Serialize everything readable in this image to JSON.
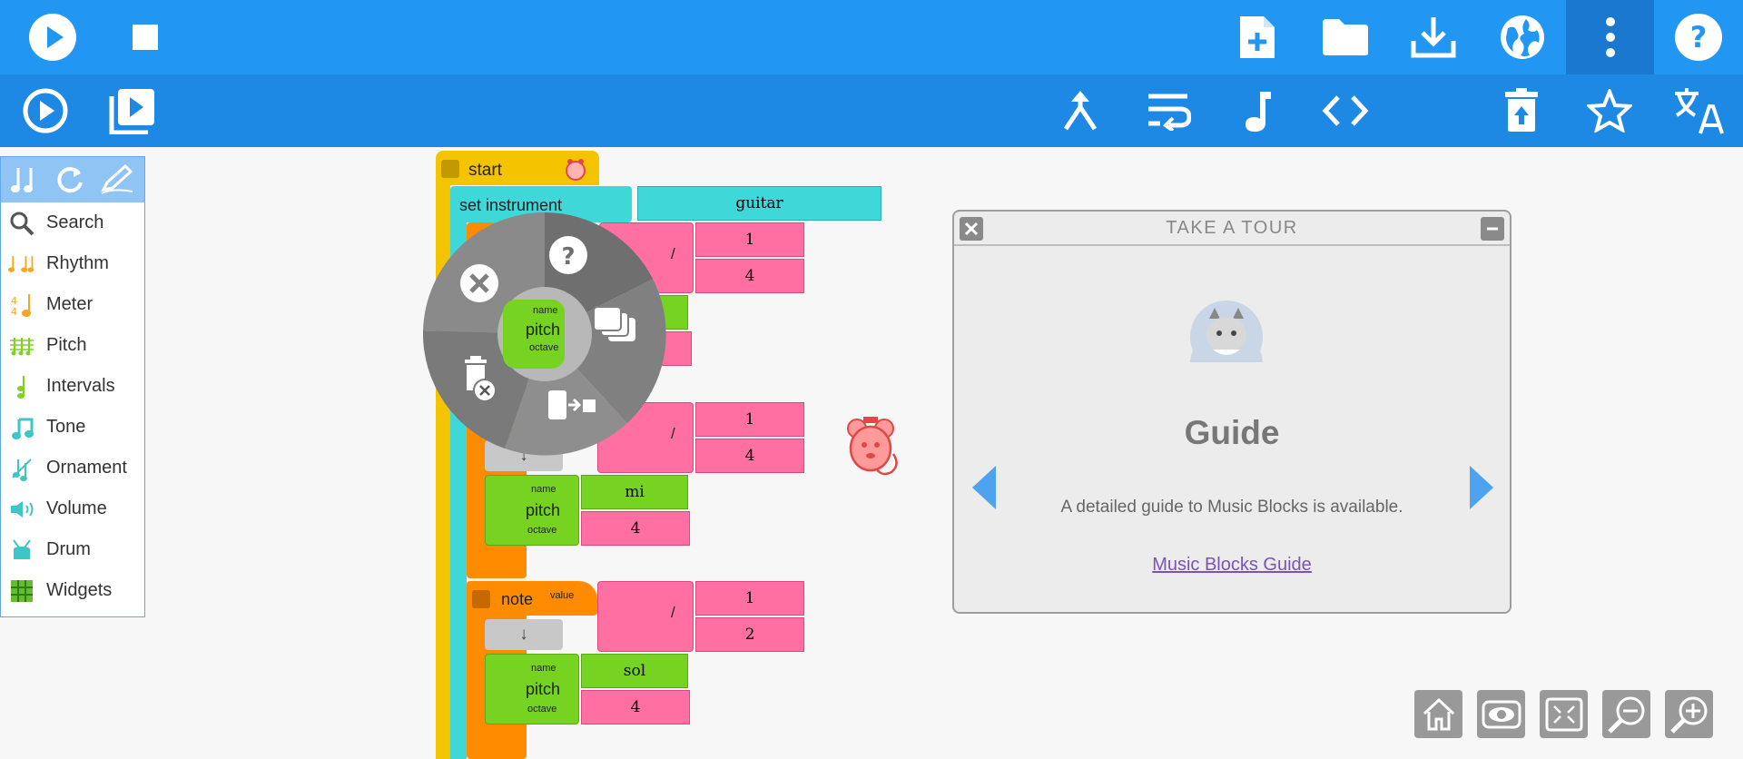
{
  "toolbar": {
    "play_icon": "play-circle-icon",
    "stop_icon": "stop-icon",
    "right_icons": [
      "new-file-icon",
      "open-folder-icon",
      "download-icon",
      "globe-icon",
      "more-vert-icon",
      "help-icon"
    ]
  },
  "aux_toolbar": {
    "left_icons": [
      "run-slow-icon",
      "run-step-icon"
    ],
    "right_icons": [
      "merge-icon",
      "wrap-icon",
      "music-note-icon",
      "code-icon",
      "restore-trash-icon",
      "star-icon",
      "translate-icon"
    ]
  },
  "palette": {
    "items": [
      {
        "label": "Search",
        "icon": "search-icon",
        "color": "#555555"
      },
      {
        "label": "Rhythm",
        "icon": "rhythm-icon",
        "color": "#f5a623"
      },
      {
        "label": "Meter",
        "icon": "meter-icon",
        "color": "#f5a623"
      },
      {
        "label": "Pitch",
        "icon": "pitch-icon",
        "color": "#7ed321"
      },
      {
        "label": "Intervals",
        "icon": "intervals-icon",
        "color": "#7ed321"
      },
      {
        "label": "Tone",
        "icon": "tone-icon",
        "color": "#3ec5c5"
      },
      {
        "label": "Ornament",
        "icon": "ornament-icon",
        "color": "#3ec5c5"
      },
      {
        "label": "Volume",
        "icon": "volume-icon",
        "color": "#3ec5c5"
      },
      {
        "label": "Drum",
        "icon": "drum-icon",
        "color": "#3ec5c5"
      },
      {
        "label": "Widgets",
        "icon": "widgets-icon",
        "color": "#66bb33"
      }
    ]
  },
  "blocks": {
    "start_label": "start",
    "set_instrument_label": "set instrument",
    "instrument_value": "guitar",
    "note_label": "note",
    "value_label": "value",
    "name_label": "name",
    "pitch_label": "pitch",
    "octave_label": "octave",
    "divide_symbol": "/",
    "arrow_symbol": "↓",
    "note1": {
      "num": "1",
      "den": "4"
    },
    "note2": {
      "num": "1",
      "den": "4",
      "pitch": "mi",
      "octave": "4"
    },
    "note3": {
      "num": "1",
      "den": "2",
      "pitch": "sol",
      "octave": "4"
    }
  },
  "pie_menu": {
    "center_name": "name",
    "center_pitch": "pitch",
    "center_octave": "octave",
    "items": [
      "close-icon",
      "help-icon",
      "duplicate-icon",
      "extract-icon",
      "delete-icon"
    ]
  },
  "tour": {
    "title": "TAKE A TOUR",
    "heading": "Guide",
    "description": "A detailed guide to Music Blocks is available.",
    "link": "Music Blocks Guide"
  },
  "zoom_controls": [
    "home-icon",
    "hide-blocks-icon",
    "collapse-icon",
    "zoom-out-icon",
    "zoom-in-icon"
  ],
  "colors": {
    "toolbar": "#2196f3",
    "toolbar_secondary": "#1e88e5",
    "start_block": "#f5c400",
    "instrument_block": "#3ed8d8",
    "note_block": "#ff8c00",
    "pitch_block": "#77d321",
    "number_block": "#ff6fa2"
  }
}
